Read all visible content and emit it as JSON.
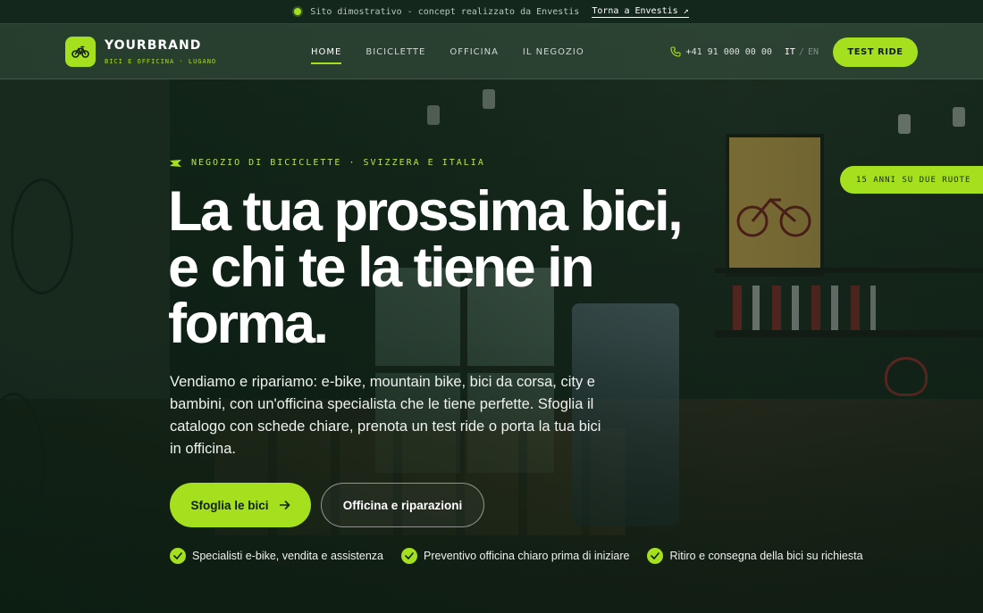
{
  "topbar": {
    "notice": "Sito dimostrativo - concept realizzato da Envestis",
    "back_link": "Torna a Envestis ↗"
  },
  "brand": {
    "name": "YOURBRAND",
    "tagline": "BICI E OFFICINA · LUGANO",
    "logo_icon": "bicycle-icon"
  },
  "nav": {
    "items": [
      {
        "label": "HOME",
        "active": true
      },
      {
        "label": "BICICLETTE",
        "active": false
      },
      {
        "label": "OFFICINA",
        "active": false
      },
      {
        "label": "IL NEGOZIO",
        "active": false
      }
    ]
  },
  "header_tools": {
    "phone": "+41 91 000 00 00",
    "phone_icon": "phone-icon",
    "lang_active": "IT",
    "lang_separator": "/",
    "lang_other": "EN",
    "cta_label": "TEST RIDE"
  },
  "hero": {
    "eyebrow": "NEGOZIO DI BICICLETTE · SVIZZERA E ITALIA",
    "title_line1": "La tua prossima bici,",
    "title_line2": "e chi te la tiene in",
    "title_line3": "forma.",
    "description": "Vendiamo e ripariamo: e-bike, mountain bike, bici da corsa, city e bambini, con un'officina specialista che le tiene perfette. Sfoglia il catalogo con schede chiare, prenota un test ride o porta la tua bici in officina.",
    "primary_button": "Sfoglia le bici",
    "secondary_button": "Officina e riparazioni",
    "features": [
      "Specialisti e-bike, vendita e assistenza",
      "Preventivo officina chiaro prima di iniziare",
      "Ritiro e consegna della bici su richiesta"
    ],
    "badge": "15 ANNI SU DUE RUOTE"
  },
  "colors": {
    "accent": "#a5e01e",
    "dark": "#13271c"
  }
}
